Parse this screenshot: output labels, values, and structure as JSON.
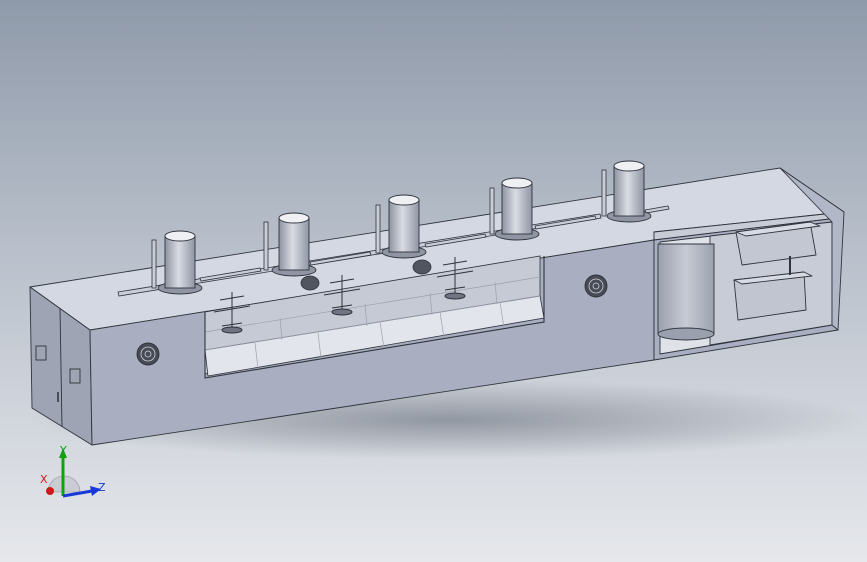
{
  "triad": {
    "x_label": "X",
    "y_label": "Y",
    "z_label": "Z",
    "x_color": "#d01818",
    "y_color": "#10a010",
    "z_color": "#1838d8"
  },
  "model": {
    "body_color": "#b6bccb",
    "top_color": "#d4d8e3",
    "front_color": "#a9afc0",
    "interior_color": "#e2e5ec",
    "line_color": "#30343d",
    "tower_count": 5
  }
}
